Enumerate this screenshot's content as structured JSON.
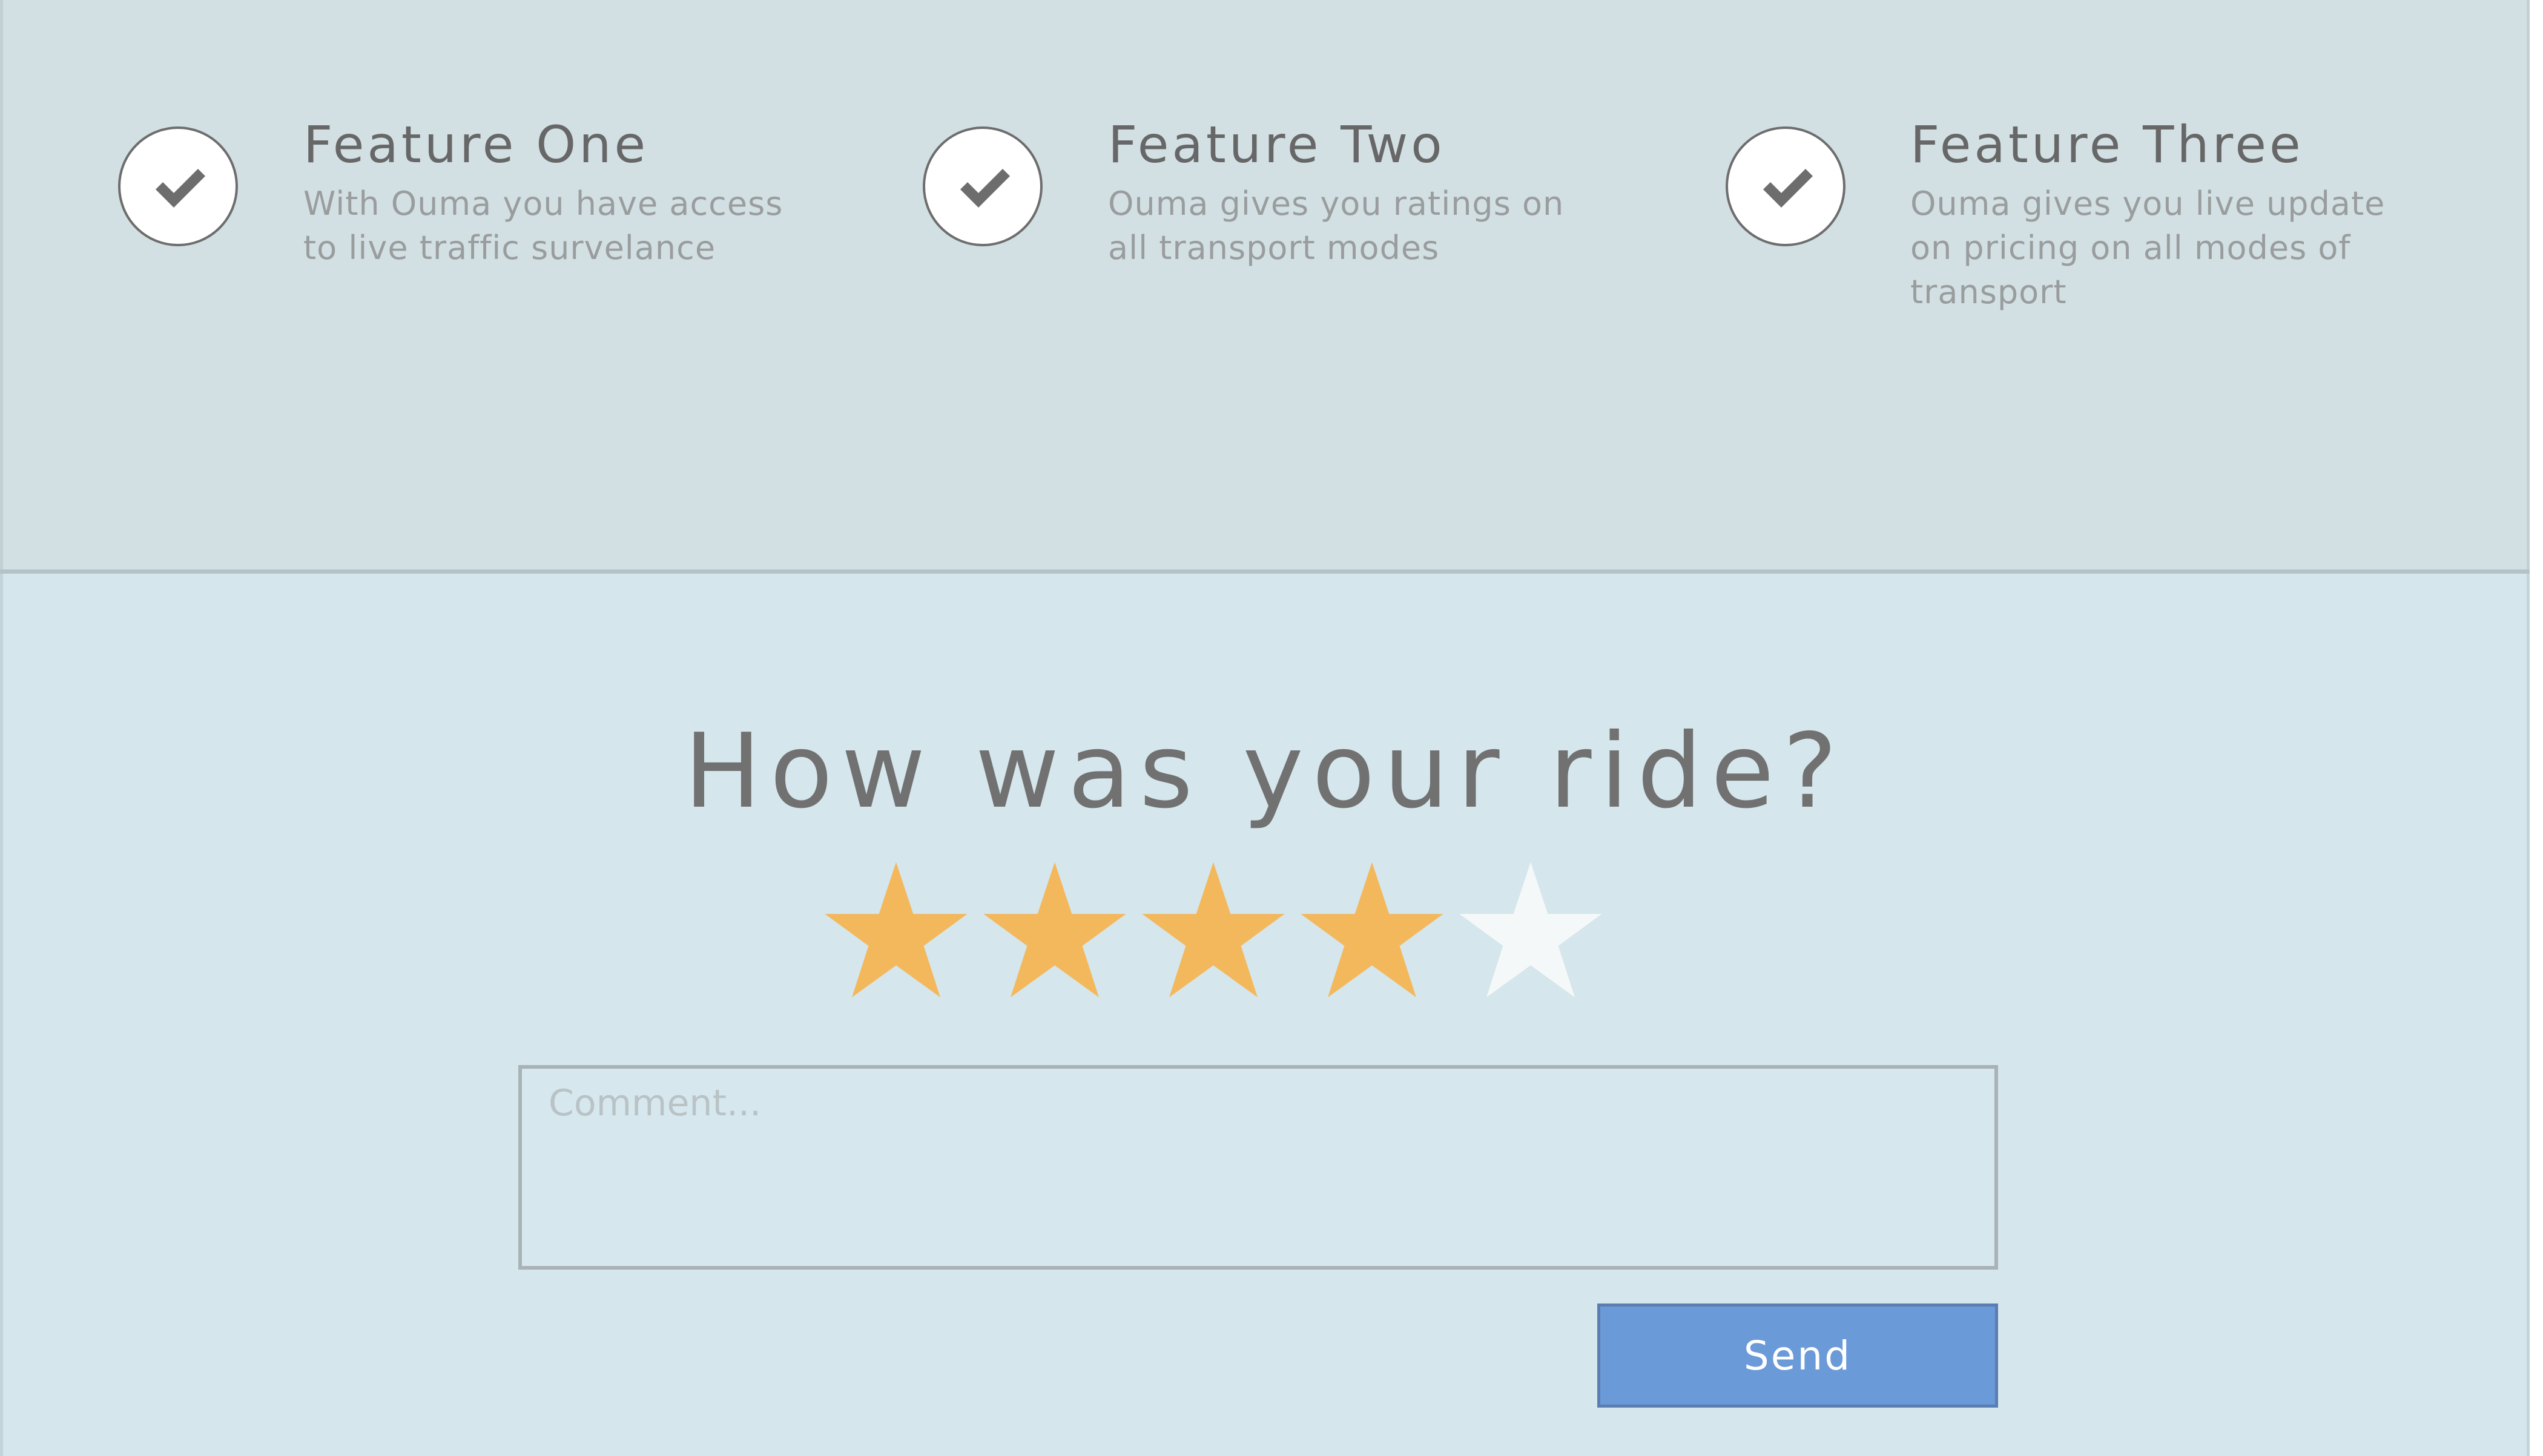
{
  "features": [
    {
      "title": "Feature One",
      "description": "With Ouma you have access to live traffic survelance",
      "icon": "check-icon"
    },
    {
      "title": "Feature Two",
      "description": "Ouma gives you ratings on all transport modes",
      "icon": "check-icon"
    },
    {
      "title": "Feature Three",
      "description": "Ouma gives you live update on pricing on all modes of transport",
      "icon": "check-icon"
    }
  ],
  "review": {
    "heading": "How was your ride?",
    "rating": 4,
    "max_rating": 5,
    "star_filled_color": "#f3b85c",
    "star_empty_color": "#f5f8f9",
    "comment_placeholder": "Comment...",
    "comment_value": "",
    "send_label": "Send"
  },
  "colors": {
    "button": "#6b9ad8",
    "background": "#d3e1e5"
  }
}
